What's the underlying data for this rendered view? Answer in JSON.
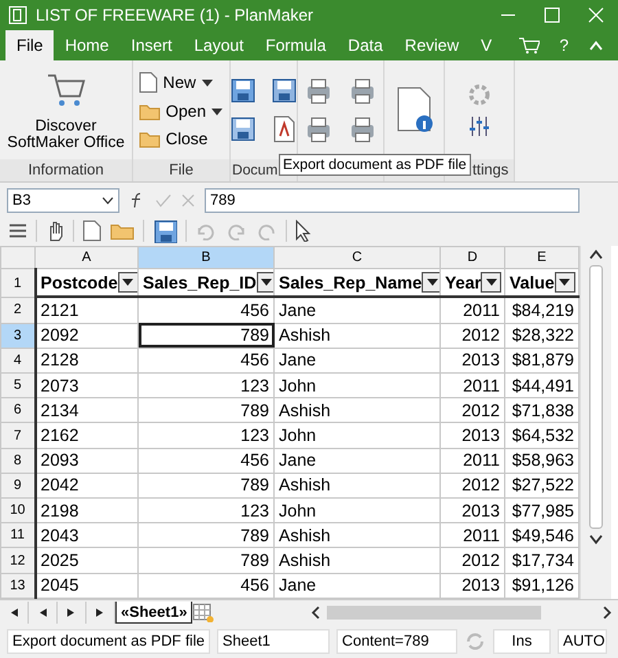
{
  "window": {
    "title": "LIST OF FREEWARE (1) - PlanMaker"
  },
  "tabs": [
    {
      "label": "File",
      "selected": true
    },
    {
      "label": "Home",
      "selected": false
    },
    {
      "label": "Insert",
      "selected": false
    },
    {
      "label": "Layout",
      "selected": false
    },
    {
      "label": "Formula",
      "selected": false
    },
    {
      "label": "Data",
      "selected": false
    },
    {
      "label": "Review",
      "selected": false
    },
    {
      "label": "V",
      "selected": false
    }
  ],
  "tab_extras": {
    "help": "?"
  },
  "ribbon": {
    "discover": "Discover\nSoftMaker Office",
    "file_items": [
      {
        "label": "New",
        "dropdown": true
      },
      {
        "label": "Open",
        "dropdown": true
      },
      {
        "label": "Close",
        "dropdown": false
      }
    ],
    "group_labels": [
      "Information",
      "File",
      "Docum",
      "ttings"
    ]
  },
  "tooltip": "Export document as PDF file",
  "formula_bar": {
    "cell_ref": "B3",
    "value": "789"
  },
  "sheet": {
    "columns": [
      {
        "letter": "A",
        "kind": "text",
        "selected": false
      },
      {
        "letter": "B",
        "kind": "number",
        "selected": true
      },
      {
        "letter": "C",
        "kind": "text",
        "selected": false
      },
      {
        "letter": "D",
        "kind": "number",
        "selected": false
      },
      {
        "letter": "E",
        "kind": "number",
        "selected": false
      }
    ],
    "rows": [
      {
        "num": "1",
        "kind": "header",
        "selected": false,
        "cells": [
          "Postcode",
          "Sales_Rep_ID",
          "Sales_Rep_Name",
          "Year",
          "Value"
        ]
      },
      {
        "num": "2",
        "kind": "data",
        "selected": false,
        "cells": [
          "2121",
          "456",
          "Jane",
          "2011",
          "$84,219"
        ]
      },
      {
        "num": "3",
        "kind": "data",
        "selected": true,
        "cells": [
          "2092",
          "789",
          "Ashish",
          "2012",
          "$28,322"
        ]
      },
      {
        "num": "4",
        "kind": "data",
        "selected": false,
        "cells": [
          "2128",
          "456",
          "Jane",
          "2013",
          "$81,879"
        ]
      },
      {
        "num": "5",
        "kind": "data",
        "selected": false,
        "cells": [
          "2073",
          "123",
          "John",
          "2011",
          "$44,491"
        ]
      },
      {
        "num": "6",
        "kind": "data",
        "selected": false,
        "cells": [
          "2134",
          "789",
          "Ashish",
          "2012",
          "$71,838"
        ]
      },
      {
        "num": "7",
        "kind": "data",
        "selected": false,
        "cells": [
          "2162",
          "123",
          "John",
          "2013",
          "$64,532"
        ]
      },
      {
        "num": "8",
        "kind": "data",
        "selected": false,
        "cells": [
          "2093",
          "456",
          "Jane",
          "2011",
          "$58,963"
        ]
      },
      {
        "num": "9",
        "kind": "data",
        "selected": false,
        "cells": [
          "2042",
          "789",
          "Ashish",
          "2012",
          "$27,522"
        ]
      },
      {
        "num": "10",
        "kind": "data",
        "selected": false,
        "cells": [
          "2198",
          "123",
          "John",
          "2013",
          "$77,985"
        ]
      },
      {
        "num": "11",
        "kind": "data",
        "selected": false,
        "cells": [
          "2043",
          "789",
          "Ashish",
          "2011",
          "$49,546"
        ]
      },
      {
        "num": "12",
        "kind": "data",
        "selected": false,
        "cells": [
          "2025",
          "789",
          "Ashish",
          "2012",
          "$17,734"
        ]
      },
      {
        "num": "13",
        "kind": "data",
        "selected": false,
        "cells": [
          "2045",
          "456",
          "Jane",
          "2013",
          "$91,126"
        ]
      }
    ]
  },
  "sheet_tabs": [
    {
      "label": "«Sheet1»",
      "selected": true
    }
  ],
  "status_bar": [
    "Export document as PDF file",
    "Sheet1",
    "Content=789",
    "Ins",
    "AUTO"
  ]
}
